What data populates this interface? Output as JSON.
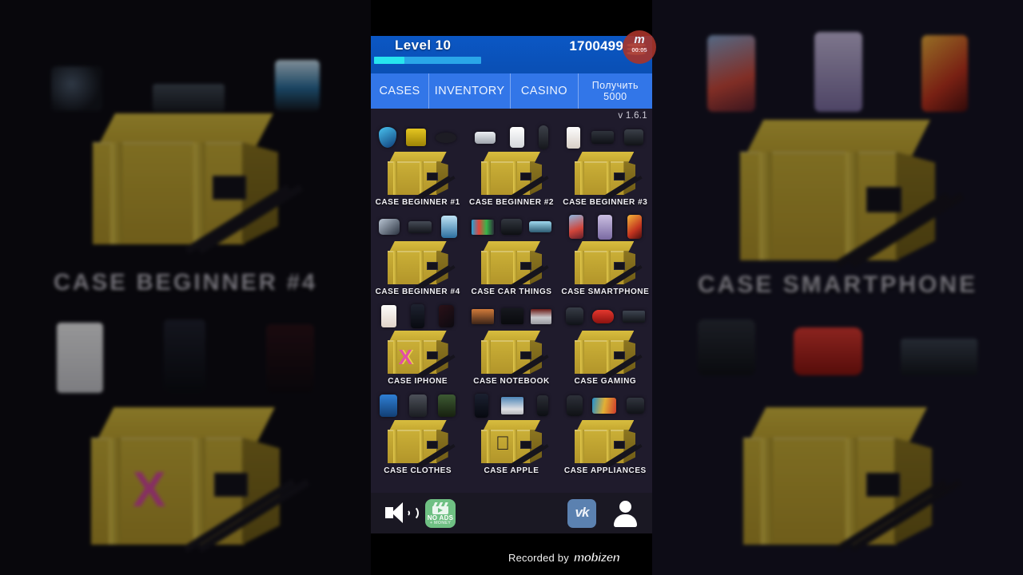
{
  "app": {
    "version_label": "v 1.6.1",
    "background_case_left": "CASE BEGINNER #4",
    "background_case_right": "CASE SMARTPHONE"
  },
  "header": {
    "level_label": "Level 10",
    "progress_percent": 28,
    "coins": "1700499",
    "coin_icon": "coin-stack-icon",
    "header_color": "#0b57c4",
    "progress_fill_color": "#27e4ee",
    "progress_track_color": "#2aa6e8"
  },
  "tabs": [
    {
      "label": "CASES",
      "active": true
    },
    {
      "label": "INVENTORY",
      "active": false
    },
    {
      "label": "CASINO",
      "active": false
    }
  ],
  "bonus_tab": {
    "line1": "Получить",
    "line2": "5000"
  },
  "cases": [
    {
      "label": "CASE BEGINNER #1",
      "logo": "",
      "items": [
        "shield-blue",
        "action-camera",
        "headband"
      ]
    },
    {
      "label": "CASE BEGINNER #2",
      "logo": "",
      "items": [
        "vr-headset",
        "earbuds-case",
        "microphone"
      ]
    },
    {
      "label": "CASE BEGINNER #3",
      "logo": "",
      "items": [
        "white-phone",
        "drone",
        "dslr-camera"
      ]
    },
    {
      "label": "CASE BEGINNER #4",
      "logo": "",
      "items": [
        "vr-goggles",
        "drone",
        "electric-scooter"
      ]
    },
    {
      "label": "CASE CAR THINGS",
      "logo": "",
      "items": [
        "car-headunit",
        "dash-camera",
        "car-mirror"
      ]
    },
    {
      "label": "CASE SMARTPHONE",
      "logo": "",
      "items": [
        "phone-red",
        "phone-purple",
        "phone-orange"
      ]
    },
    {
      "label": "CASE IPHONE",
      "logo": "X",
      "items": [
        "iphone-white",
        "iphone-x",
        "iphone-black"
      ]
    },
    {
      "label": "CASE NOTEBOOK",
      "logo": "",
      "items": [
        "laptop-scenery",
        "laptop-alien",
        "macbook"
      ]
    },
    {
      "label": "CASE GAMING",
      "logo": "",
      "items": [
        "gaming-headset",
        "ps-controller",
        "keyboard"
      ]
    },
    {
      "label": "CASE CLOTHES",
      "logo": "",
      "items": [
        "blue-jacket",
        "grey-jacket",
        "green-jacket"
      ]
    },
    {
      "label": "CASE APPLE",
      "logo": "",
      "items": [
        "iphone-x",
        "imac",
        "mac-pro"
      ]
    },
    {
      "label": "CASE APPLIANCES",
      "logo": "",
      "items": [
        "gaming-chair",
        "curved-monitor",
        "vacuum"
      ]
    }
  ],
  "bottom_bar": {
    "sound_icon": "speaker-on-icon",
    "no_ads_button": {
      "line1": "NO ADS",
      "line2": "+ MONEY",
      "icon": "clapperboard-icon",
      "color": "#6fc083"
    },
    "vk_button": {
      "label": "vk",
      "icon": "vk-icon",
      "color": "#5b81b0"
    },
    "account_button": {
      "icon": "user-avatar-icon"
    }
  },
  "overlay": {
    "rec_badge": {
      "logo": "m",
      "timer": "00:05"
    },
    "watermark_text": "Recorded by",
    "watermark_logo": "mobizen"
  }
}
